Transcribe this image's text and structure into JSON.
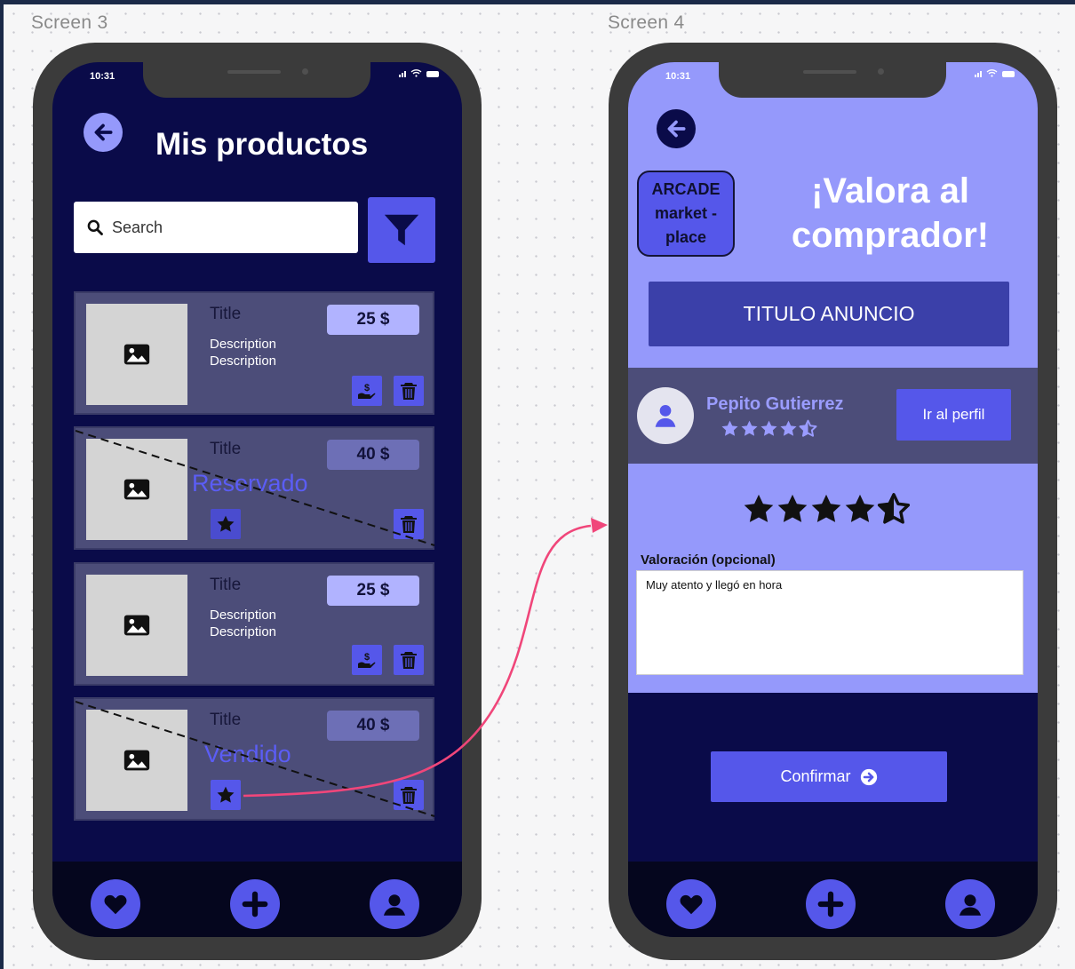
{
  "canvas": {
    "screen_labels": [
      "Screen 3",
      "Screen 4"
    ]
  },
  "screen3": {
    "status_time": "10:31",
    "title": "Mis productos",
    "search": {
      "placeholder": "Search"
    },
    "cards": [
      {
        "title": "Title",
        "description": "Description Description",
        "price": "25 $",
        "state": ""
      },
      {
        "title": "Title",
        "description": "",
        "price": "40 $",
        "state": "Reservado"
      },
      {
        "title": "Title",
        "description": "Description Description",
        "price": "25 $",
        "state": ""
      },
      {
        "title": "Title",
        "description": "",
        "price": "40 $",
        "state": "Vendido"
      }
    ]
  },
  "screen4": {
    "status_time": "10:31",
    "logo_lines": [
      "ARCADE",
      "market -",
      "place"
    ],
    "title": "¡Valora al comprador!",
    "ad_title": "TITULO ANUNCIO",
    "seller": {
      "name": "Pepito Gutierrez",
      "rating": 4.5
    },
    "profile_button": "Ir al perfil",
    "rating": 4.5,
    "review_label": "Valoración (opcional)",
    "review_text": "Muy atento y llegó en hora",
    "confirm_button": "Confirmar"
  },
  "colors": {
    "dark_navy": "#0a0b49",
    "accent": "#5557ea",
    "light_purple": "#9599fb",
    "card_bg": "#4c4d79",
    "state_label": "#5b5df6",
    "connector": "#f0467a"
  },
  "icons": {
    "back": "arrow-left-circle",
    "filter": "funnel",
    "sell": "hand-dollar",
    "delete": "trash",
    "reserved": "star-badge",
    "nav": [
      "heart",
      "plus",
      "user"
    ]
  }
}
